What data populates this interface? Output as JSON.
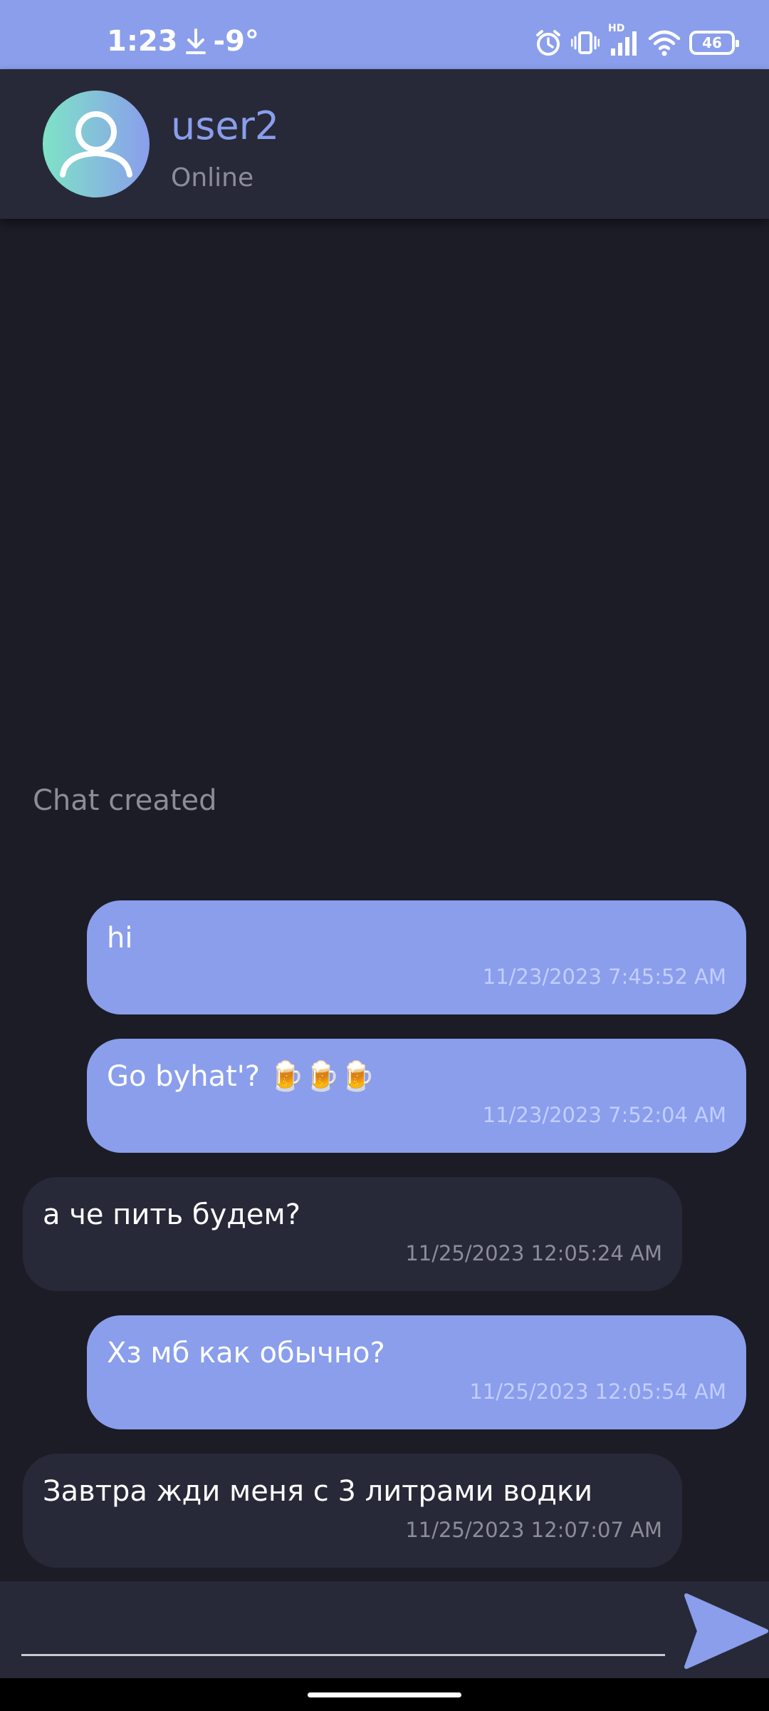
{
  "status_bar": {
    "time": "1:23",
    "temperature": "-9°",
    "network_label": "HD",
    "battery": "46",
    "icons": [
      "download-icon",
      "alarm-icon",
      "vibrate-icon",
      "signal-icon",
      "wifi-icon",
      "battery-icon"
    ]
  },
  "header": {
    "name": "user2",
    "status": "Online"
  },
  "system_note": "Chat created",
  "messages": [
    {
      "direction": "out",
      "text": "hi",
      "time": "11/23/2023 7:45:52 AM"
    },
    {
      "direction": "out",
      "text": "Go byhat'? 🍺🍺🍺",
      "time": "11/23/2023 7:52:04 AM"
    },
    {
      "direction": "in",
      "text": "а че пить будем?",
      "time": "11/25/2023 12:05:24 AM"
    },
    {
      "direction": "out",
      "text": "Хз мб как обычно?",
      "time": "11/25/2023 12:05:54 AM"
    },
    {
      "direction": "in",
      "text": "Завтра жди меня с 3 литрами водки",
      "time": "11/25/2023 12:07:07 AM"
    }
  ],
  "composer": {
    "value": "",
    "placeholder": ""
  },
  "colors": {
    "accent": "#8a9eec",
    "background": "#1c1c26",
    "surface": "#272938",
    "muted_text": "#8c8d98"
  }
}
